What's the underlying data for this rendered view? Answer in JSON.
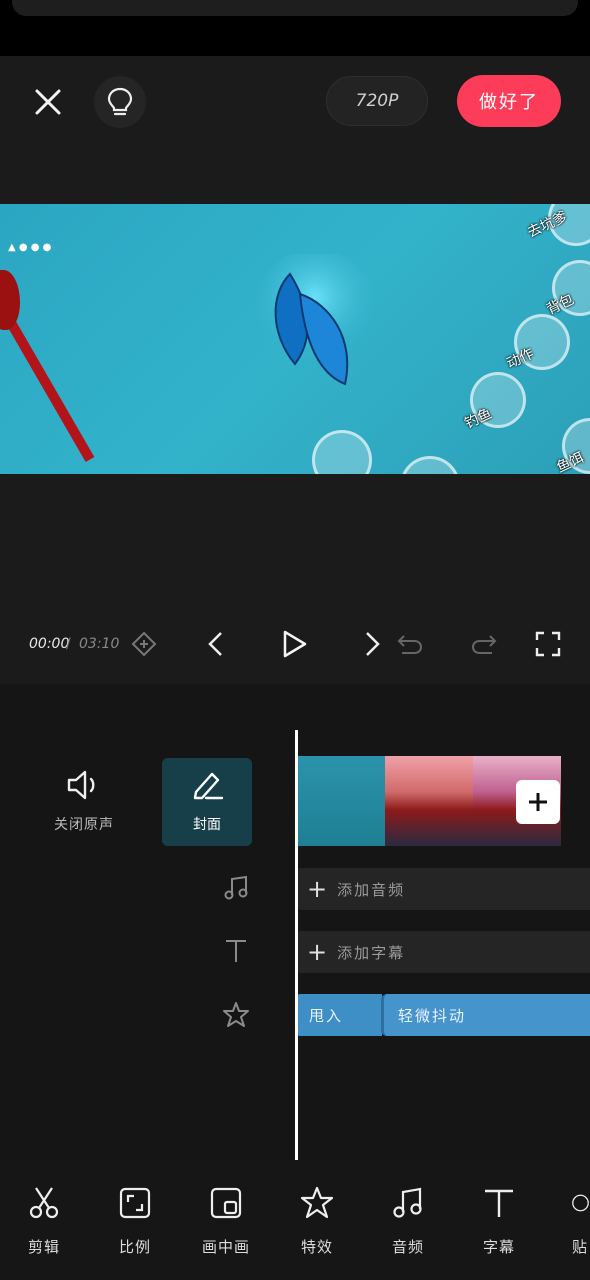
{
  "topbar": {
    "resolution": "720P",
    "done_label": "做好了"
  },
  "preview": {
    "game_labels": [
      "去坑爹",
      "背包",
      "动作",
      "钓鱼",
      "鱼饵"
    ]
  },
  "playback": {
    "current_time": "00:00",
    "separator": "/",
    "total_time": "03:10"
  },
  "timeline": {
    "mute_label": "关闭原声",
    "cover_label": "封面",
    "add_audio": "添加音频",
    "add_caption": "添加字幕",
    "effects": [
      "甩入",
      "轻微抖动"
    ]
  },
  "toolbar": {
    "items": [
      {
        "label": "剪辑",
        "icon": "scissors-icon"
      },
      {
        "label": "比例",
        "icon": "ratio-icon"
      },
      {
        "label": "画中画",
        "icon": "pip-icon"
      },
      {
        "label": "特效",
        "icon": "effects-icon"
      },
      {
        "label": "音频",
        "icon": "music-icon"
      },
      {
        "label": "字幕",
        "icon": "text-icon"
      },
      {
        "label": "贴",
        "icon": "sticker-icon"
      }
    ]
  },
  "colors": {
    "accent": "#fd3c59",
    "effect_track": "#4594cc",
    "background": "#151515"
  }
}
